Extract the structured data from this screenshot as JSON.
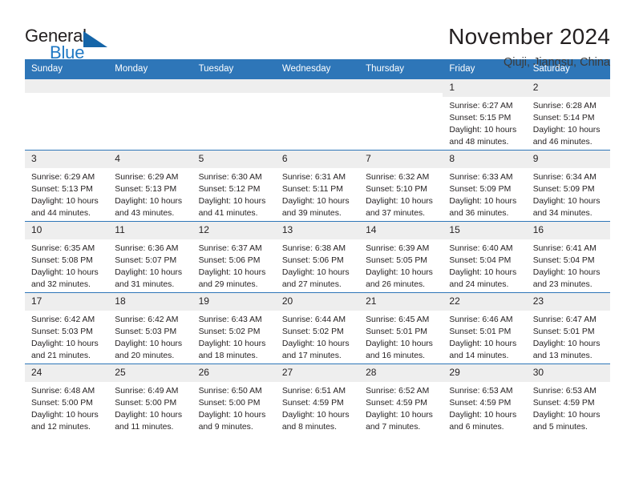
{
  "logo": {
    "word_one": "General",
    "word_two": "Blue",
    "triangle_color": "#1565a8",
    "blue_color": "#2079c4"
  },
  "header": {
    "title": "November 2024",
    "subtitle": "Qiuji, Jiangsu, China"
  },
  "theme": {
    "header_blue": "#2e76b8",
    "day_band_gray": "#eeeeee",
    "text": "#231f20"
  },
  "calendar": {
    "weekdays": [
      "Sunday",
      "Monday",
      "Tuesday",
      "Wednesday",
      "Thursday",
      "Friday",
      "Saturday"
    ],
    "weeks": [
      [
        {
          "day": "",
          "empty": true
        },
        {
          "day": "",
          "empty": true
        },
        {
          "day": "",
          "empty": true
        },
        {
          "day": "",
          "empty": true
        },
        {
          "day": "",
          "empty": true
        },
        {
          "day": "1",
          "sunrise": "Sunrise: 6:27 AM",
          "sunset": "Sunset: 5:15 PM",
          "daylight": "Daylight: 10 hours and 48 minutes."
        },
        {
          "day": "2",
          "sunrise": "Sunrise: 6:28 AM",
          "sunset": "Sunset: 5:14 PM",
          "daylight": "Daylight: 10 hours and 46 minutes."
        }
      ],
      [
        {
          "day": "3",
          "sunrise": "Sunrise: 6:29 AM",
          "sunset": "Sunset: 5:13 PM",
          "daylight": "Daylight: 10 hours and 44 minutes."
        },
        {
          "day": "4",
          "sunrise": "Sunrise: 6:29 AM",
          "sunset": "Sunset: 5:13 PM",
          "daylight": "Daylight: 10 hours and 43 minutes."
        },
        {
          "day": "5",
          "sunrise": "Sunrise: 6:30 AM",
          "sunset": "Sunset: 5:12 PM",
          "daylight": "Daylight: 10 hours and 41 minutes."
        },
        {
          "day": "6",
          "sunrise": "Sunrise: 6:31 AM",
          "sunset": "Sunset: 5:11 PM",
          "daylight": "Daylight: 10 hours and 39 minutes."
        },
        {
          "day": "7",
          "sunrise": "Sunrise: 6:32 AM",
          "sunset": "Sunset: 5:10 PM",
          "daylight": "Daylight: 10 hours and 37 minutes."
        },
        {
          "day": "8",
          "sunrise": "Sunrise: 6:33 AM",
          "sunset": "Sunset: 5:09 PM",
          "daylight": "Daylight: 10 hours and 36 minutes."
        },
        {
          "day": "9",
          "sunrise": "Sunrise: 6:34 AM",
          "sunset": "Sunset: 5:09 PM",
          "daylight": "Daylight: 10 hours and 34 minutes."
        }
      ],
      [
        {
          "day": "10",
          "sunrise": "Sunrise: 6:35 AM",
          "sunset": "Sunset: 5:08 PM",
          "daylight": "Daylight: 10 hours and 32 minutes."
        },
        {
          "day": "11",
          "sunrise": "Sunrise: 6:36 AM",
          "sunset": "Sunset: 5:07 PM",
          "daylight": "Daylight: 10 hours and 31 minutes."
        },
        {
          "day": "12",
          "sunrise": "Sunrise: 6:37 AM",
          "sunset": "Sunset: 5:06 PM",
          "daylight": "Daylight: 10 hours and 29 minutes."
        },
        {
          "day": "13",
          "sunrise": "Sunrise: 6:38 AM",
          "sunset": "Sunset: 5:06 PM",
          "daylight": "Daylight: 10 hours and 27 minutes."
        },
        {
          "day": "14",
          "sunrise": "Sunrise: 6:39 AM",
          "sunset": "Sunset: 5:05 PM",
          "daylight": "Daylight: 10 hours and 26 minutes."
        },
        {
          "day": "15",
          "sunrise": "Sunrise: 6:40 AM",
          "sunset": "Sunset: 5:04 PM",
          "daylight": "Daylight: 10 hours and 24 minutes."
        },
        {
          "day": "16",
          "sunrise": "Sunrise: 6:41 AM",
          "sunset": "Sunset: 5:04 PM",
          "daylight": "Daylight: 10 hours and 23 minutes."
        }
      ],
      [
        {
          "day": "17",
          "sunrise": "Sunrise: 6:42 AM",
          "sunset": "Sunset: 5:03 PM",
          "daylight": "Daylight: 10 hours and 21 minutes."
        },
        {
          "day": "18",
          "sunrise": "Sunrise: 6:42 AM",
          "sunset": "Sunset: 5:03 PM",
          "daylight": "Daylight: 10 hours and 20 minutes."
        },
        {
          "day": "19",
          "sunrise": "Sunrise: 6:43 AM",
          "sunset": "Sunset: 5:02 PM",
          "daylight": "Daylight: 10 hours and 18 minutes."
        },
        {
          "day": "20",
          "sunrise": "Sunrise: 6:44 AM",
          "sunset": "Sunset: 5:02 PM",
          "daylight": "Daylight: 10 hours and 17 minutes."
        },
        {
          "day": "21",
          "sunrise": "Sunrise: 6:45 AM",
          "sunset": "Sunset: 5:01 PM",
          "daylight": "Daylight: 10 hours and 16 minutes."
        },
        {
          "day": "22",
          "sunrise": "Sunrise: 6:46 AM",
          "sunset": "Sunset: 5:01 PM",
          "daylight": "Daylight: 10 hours and 14 minutes."
        },
        {
          "day": "23",
          "sunrise": "Sunrise: 6:47 AM",
          "sunset": "Sunset: 5:01 PM",
          "daylight": "Daylight: 10 hours and 13 minutes."
        }
      ],
      [
        {
          "day": "24",
          "sunrise": "Sunrise: 6:48 AM",
          "sunset": "Sunset: 5:00 PM",
          "daylight": "Daylight: 10 hours and 12 minutes."
        },
        {
          "day": "25",
          "sunrise": "Sunrise: 6:49 AM",
          "sunset": "Sunset: 5:00 PM",
          "daylight": "Daylight: 10 hours and 11 minutes."
        },
        {
          "day": "26",
          "sunrise": "Sunrise: 6:50 AM",
          "sunset": "Sunset: 5:00 PM",
          "daylight": "Daylight: 10 hours and 9 minutes."
        },
        {
          "day": "27",
          "sunrise": "Sunrise: 6:51 AM",
          "sunset": "Sunset: 4:59 PM",
          "daylight": "Daylight: 10 hours and 8 minutes."
        },
        {
          "day": "28",
          "sunrise": "Sunrise: 6:52 AM",
          "sunset": "Sunset: 4:59 PM",
          "daylight": "Daylight: 10 hours and 7 minutes."
        },
        {
          "day": "29",
          "sunrise": "Sunrise: 6:53 AM",
          "sunset": "Sunset: 4:59 PM",
          "daylight": "Daylight: 10 hours and 6 minutes."
        },
        {
          "day": "30",
          "sunrise": "Sunrise: 6:53 AM",
          "sunset": "Sunset: 4:59 PM",
          "daylight": "Daylight: 10 hours and 5 minutes."
        }
      ]
    ]
  }
}
